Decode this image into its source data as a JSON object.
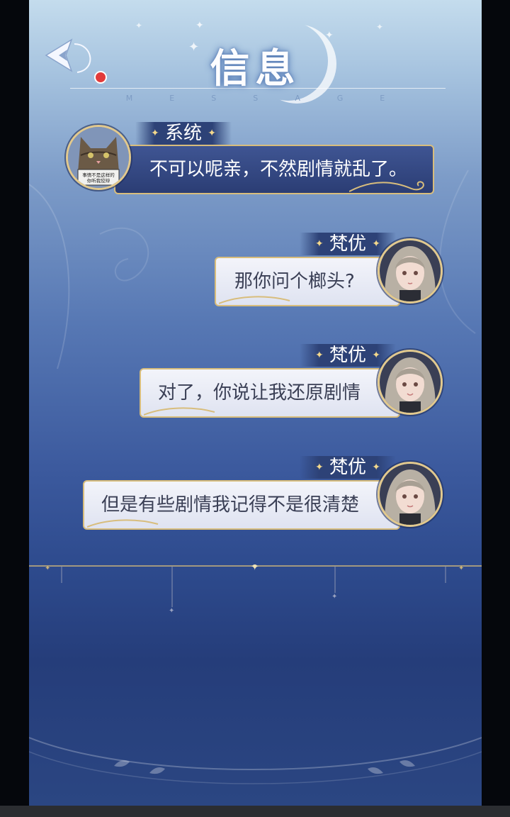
{
  "header": {
    "title": "信息",
    "subtitle": "MESSAGE",
    "back_icon": "back-arrow-icon",
    "badge_color": "#e23b3b"
  },
  "messages": [
    {
      "sender": "系统",
      "text": "不可以呢亲，不然剧情就乱了。",
      "side": "left",
      "avatar": "cat-avatar",
      "avatar_sign": "事情不是这样的 你听我狡辩"
    },
    {
      "sender": "梵优",
      "text": "那你问个榔头?",
      "side": "right",
      "avatar": "girl-avatar"
    },
    {
      "sender": "梵优",
      "text": "对了，你说让我还原剧情",
      "side": "right",
      "avatar": "girl-avatar"
    },
    {
      "sender": "梵优",
      "text": "但是有些剧情我记得不是很清楚",
      "side": "right",
      "avatar": "girl-avatar"
    }
  ],
  "colors": {
    "gold": "#d8bd7c",
    "dark_bubble": "#34497f",
    "light_bubble": "#eceef7"
  }
}
